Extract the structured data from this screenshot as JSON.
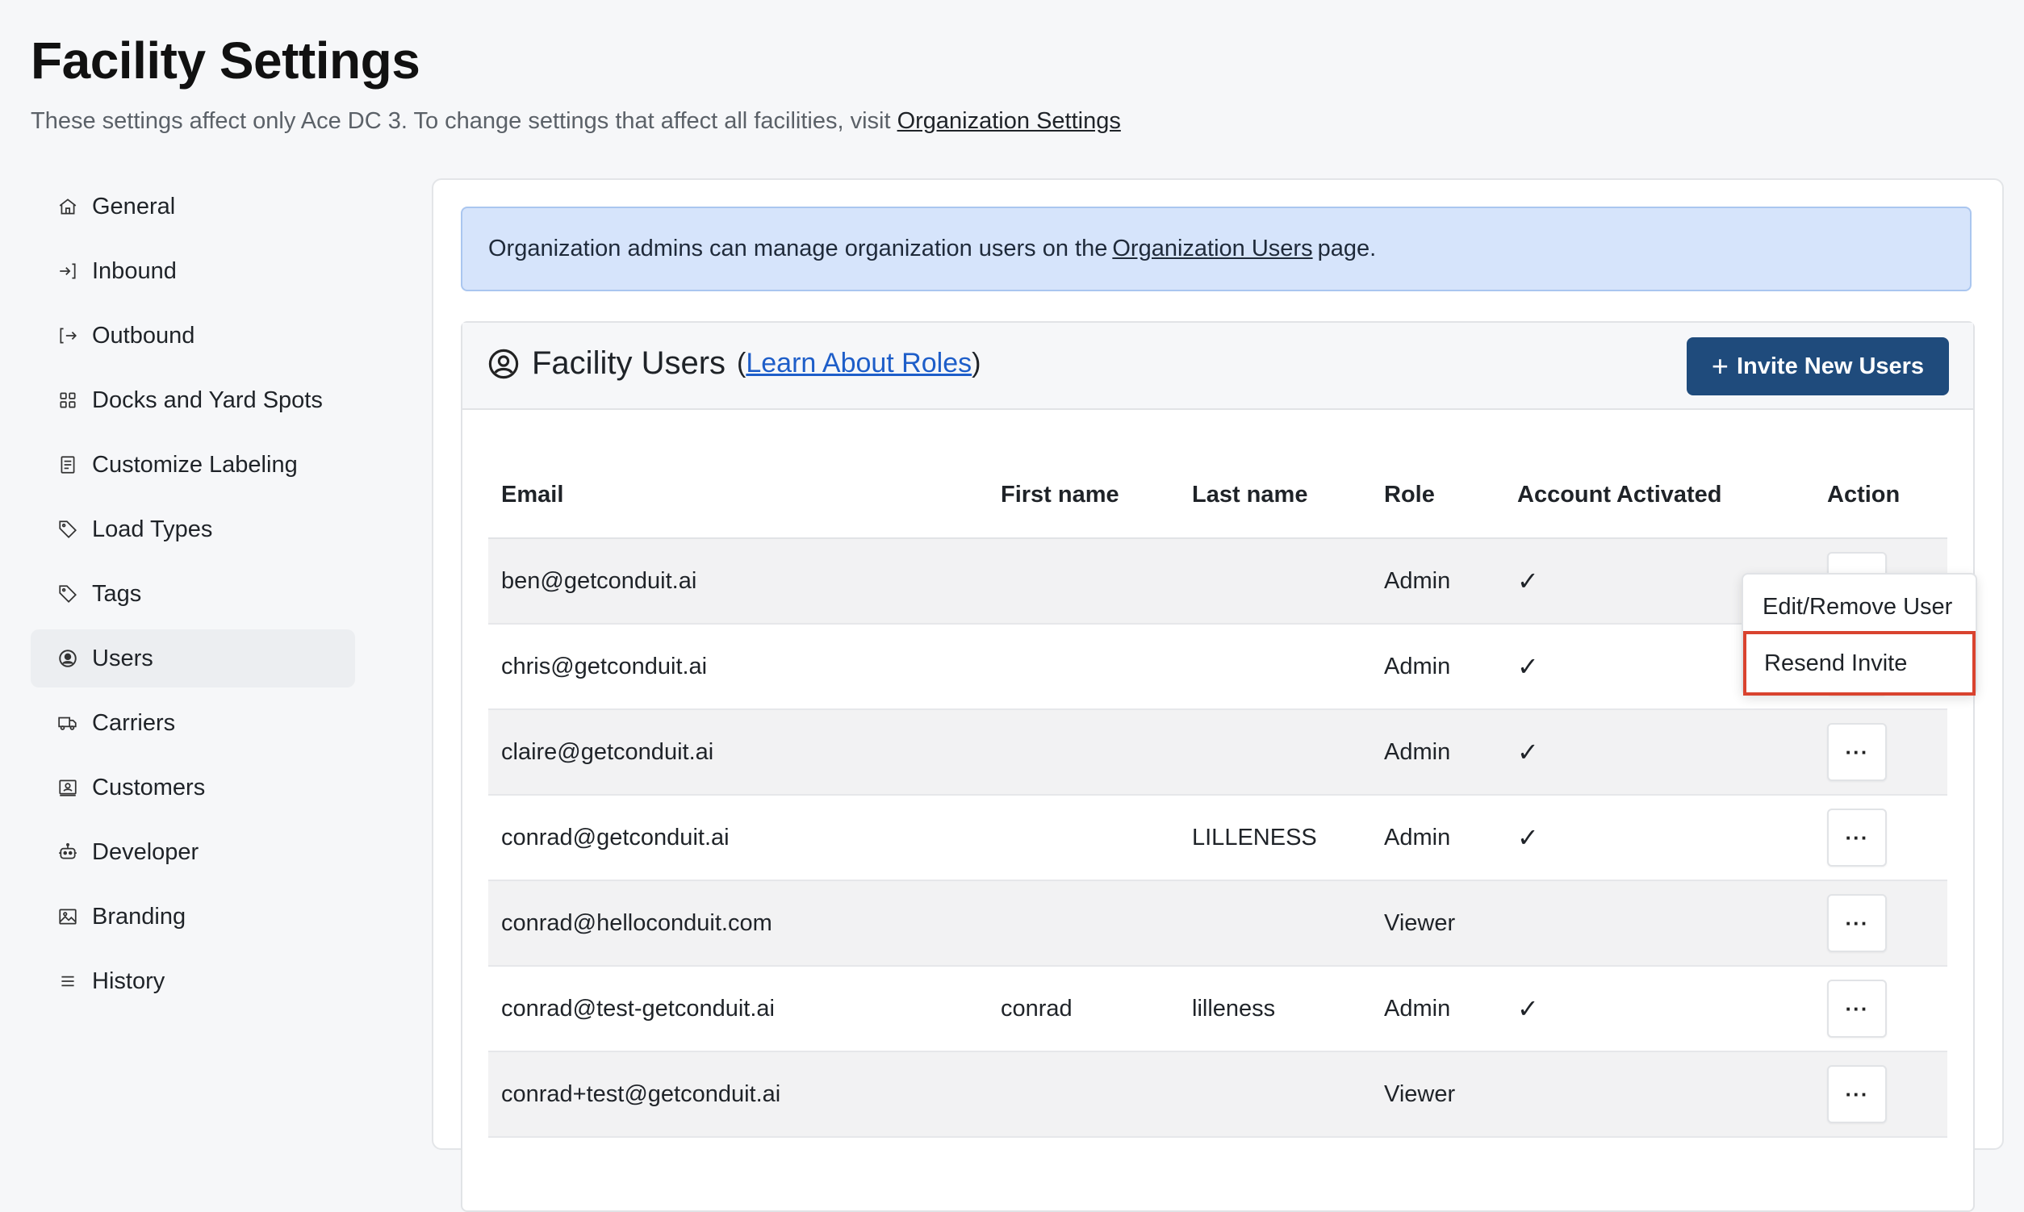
{
  "header": {
    "title": "Facility Settings",
    "subtitle_prefix": "These settings affect only Ace DC 3. To change settings that affect all facilities, visit",
    "subtitle_link": "Organization Settings"
  },
  "sidebar": {
    "items": [
      {
        "label": "General",
        "icon": "home-icon"
      },
      {
        "label": "Inbound",
        "icon": "inbound-icon"
      },
      {
        "label": "Outbound",
        "icon": "outbound-icon"
      },
      {
        "label": "Docks and Yard Spots",
        "icon": "grid-icon"
      },
      {
        "label": "Customize Labeling",
        "icon": "label-icon"
      },
      {
        "label": "Load Types",
        "icon": "tag-icon"
      },
      {
        "label": "Tags",
        "icon": "tag-icon"
      },
      {
        "label": "Users",
        "icon": "user-circle-icon",
        "active": true
      },
      {
        "label": "Carriers",
        "icon": "truck-icon"
      },
      {
        "label": "Customers",
        "icon": "contact-icon"
      },
      {
        "label": "Developer",
        "icon": "robot-icon"
      },
      {
        "label": "Branding",
        "icon": "image-icon"
      },
      {
        "label": "History",
        "icon": "list-icon"
      }
    ]
  },
  "banner": {
    "prefix": "Organization admins can manage organization users on the",
    "link": "Organization Users",
    "suffix": "page."
  },
  "users_panel": {
    "title": "Facility Users",
    "roles_link": "Learn About Roles",
    "invite_label": "Invite New Users",
    "columns": [
      "Email",
      "First name",
      "Last name",
      "Role",
      "Account Activated",
      "Action"
    ],
    "rows": [
      {
        "email": "ben@getconduit.ai",
        "first": "",
        "last": "",
        "role": "Admin",
        "activated": "✓"
      },
      {
        "email": "chris@getconduit.ai",
        "first": "",
        "last": "",
        "role": "Admin",
        "activated": "✓"
      },
      {
        "email": "claire@getconduit.ai",
        "first": "",
        "last": "",
        "role": "Admin",
        "activated": "✓"
      },
      {
        "email": "conrad@getconduit.ai",
        "first": "",
        "last": "LILLENESS",
        "role": "Admin",
        "activated": "✓"
      },
      {
        "email": "conrad@helloconduit.com",
        "first": "",
        "last": "",
        "role": "Viewer",
        "activated": ""
      },
      {
        "email": "conrad@test-getconduit.ai",
        "first": "conrad",
        "last": "lilleness",
        "role": "Admin",
        "activated": "✓"
      },
      {
        "email": "conrad+test@getconduit.ai",
        "first": "",
        "last": "",
        "role": "Viewer",
        "activated": ""
      }
    ],
    "action_button": "···"
  },
  "action_menu": {
    "edit_label": "Edit/Remove User",
    "resend_label": "Resend Invite"
  },
  "colors": {
    "primary_button": "#1f4b7c",
    "banner_bg": "#d6e4fb",
    "check": "#2e9b4f",
    "highlight": "#d9432f"
  }
}
